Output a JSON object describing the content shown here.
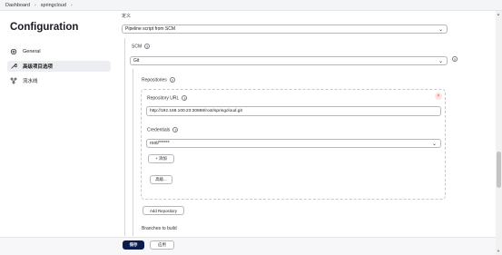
{
  "breadcrumb": {
    "items": [
      "Dashboard",
      "springcloud"
    ],
    "separator": "›"
  },
  "page": {
    "title": "Configuration"
  },
  "sidebar": {
    "items": [
      {
        "label": "General",
        "icon": "gear-icon",
        "active": false
      },
      {
        "label": "高级项目选项",
        "icon": "wrench-icon",
        "active": true
      },
      {
        "label": "流水线",
        "icon": "pipeline-icon",
        "active": false
      }
    ]
  },
  "definition": {
    "label": "定义",
    "value": "Pipeline script from SCM"
  },
  "scm": {
    "label": "SCM",
    "help": "?",
    "value": "Git"
  },
  "repositories": {
    "label": "Repositories",
    "help": "?",
    "url_label": "Repository URL",
    "url_value": "http://192.168.100.23:30888/root/springcloud.git",
    "credentials_label": "Credentials",
    "credentials_value": "root/******",
    "add_credential_label": "+ 添加",
    "advanced_label": "高级...",
    "close_glyph": "×"
  },
  "add_repository_label": "Add Repository",
  "branches_label": "Branches to build",
  "footer": {
    "save_label": "保存",
    "apply_label": "应用"
  },
  "colors": {
    "primary_button": "#0b1c4d",
    "close_icon": "#dd3333"
  }
}
